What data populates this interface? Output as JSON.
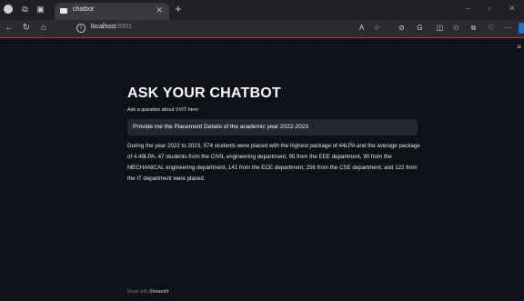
{
  "browser": {
    "tab_title": "chatbot",
    "new_tab_symbol": "+",
    "address": {
      "host": "localhost",
      "port": ":8501"
    }
  },
  "app": {
    "title": "ASK YOUR CHATBOT",
    "question_label": "Ask a question about VVIT here:",
    "question_value": "Provide me the Placement Details of the academic year 2022-2023",
    "answer": "During the year 2022 to 2023, 574 students were placed with the highest package of 44LPA and the average package of 4.49LPA. 47 students from the CIVIL engineering department, 95 from the EEE department, 90 from the MECHANICAL engineering department, 141 from the ECE department, 256 from the CSE department, and 122 from the IT department were placed.",
    "footer_prefix": "Made with",
    "footer_brand": "Streamlit"
  }
}
